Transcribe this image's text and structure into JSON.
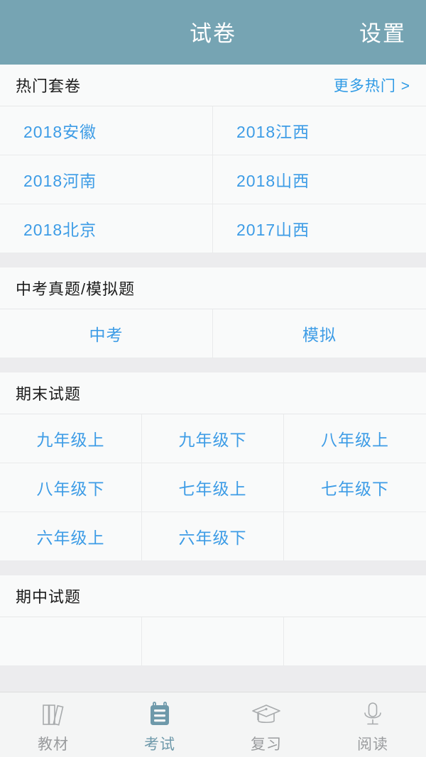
{
  "appbar": {
    "title": "试卷",
    "settings_label": "设置",
    "bg_color": "#76a4b3",
    "text_color": "#ffffff"
  },
  "theme": {
    "link_blue": "#3d9ce6",
    "accent_teal": "#6e99aa",
    "page_bg": "#f7f8f8",
    "separator": "#ececee"
  },
  "sections": [
    {
      "title": "热门套卷",
      "more_label": "更多热门 >",
      "columns": 2,
      "align": "left",
      "items": [
        "2018安徽",
        "2018江西",
        "2018河南",
        "2018山西",
        "2018北京",
        "2017山西"
      ]
    },
    {
      "title": "中考真题/模拟题",
      "more_label": "",
      "columns": 2,
      "align": "center",
      "items": [
        "中考",
        "模拟"
      ]
    },
    {
      "title": "期末试题",
      "more_label": "",
      "columns": 3,
      "align": "center",
      "items": [
        "九年级上",
        "九年级下",
        "八年级上",
        "八年级下",
        "七年级上",
        "七年级下",
        "六年级上",
        "六年级下",
        ""
      ]
    },
    {
      "title": "期中试题",
      "more_label": "",
      "columns": 3,
      "align": "center",
      "items": [
        "",
        "",
        ""
      ]
    }
  ],
  "tabbar": {
    "tabs": [
      {
        "label": "教材",
        "icon": "books-icon",
        "active": false
      },
      {
        "label": "考试",
        "icon": "notepad-icon",
        "active": true
      },
      {
        "label": "复习",
        "icon": "graduation-cap-icon",
        "active": false
      },
      {
        "label": "阅读",
        "icon": "microphone-icon",
        "active": false
      }
    ]
  }
}
